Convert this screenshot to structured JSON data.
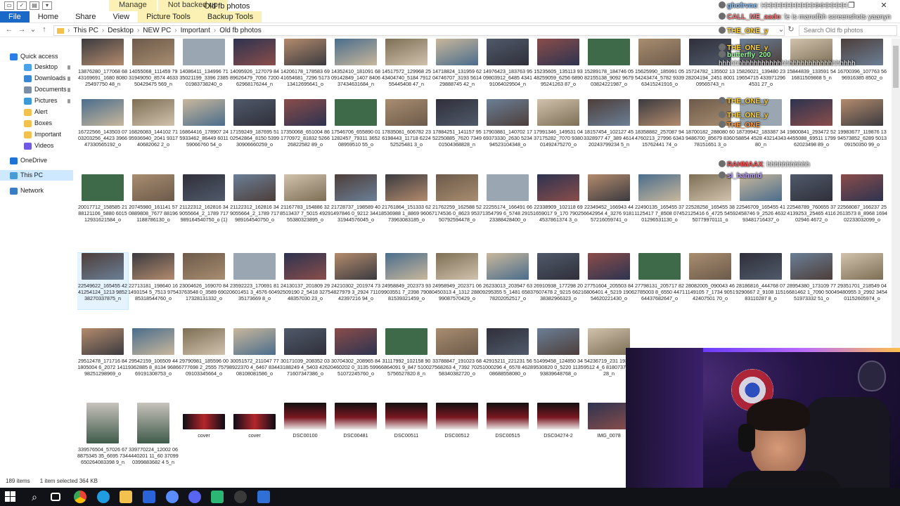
{
  "window": {
    "title": "Old fb photos",
    "context_tabs": [
      "Manage",
      "Not backed up"
    ],
    "menu_tabs": [
      "File",
      "Home",
      "Share",
      "View",
      "Picture Tools",
      "Backup Tools"
    ]
  },
  "address": {
    "crumbs": [
      "This PC",
      "Desktop",
      "NEW PC",
      "Important",
      "Old fb photos"
    ],
    "search_placeholder": "Search Old fb photos"
  },
  "sidebar": {
    "items": [
      {
        "label": "Quick access",
        "icon": "star-icon",
        "color": "#2b7de9",
        "pinned": false
      },
      {
        "label": "Desktop",
        "icon": "desktop-icon",
        "color": "#4aa3e8",
        "pinned": true
      },
      {
        "label": "Downloads",
        "icon": "download-icon",
        "color": "#3b86d4",
        "pinned": true
      },
      {
        "label": "Documents",
        "icon": "document-icon",
        "color": "#7a8fa6",
        "pinned": true
      },
      {
        "label": "Pictures",
        "icon": "pictures-icon",
        "color": "#3c9ad9",
        "pinned": true
      },
      {
        "label": "Alert",
        "icon": "folder-icon",
        "color": "#f2c14e",
        "pinned": false
      },
      {
        "label": "Boxes",
        "icon": "folder-icon",
        "color": "#f2c14e",
        "pinned": false
      },
      {
        "label": "Important",
        "icon": "folder-icon",
        "color": "#f2c14e",
        "pinned": false
      },
      {
        "label": "Videos",
        "icon": "video-icon",
        "color": "#6e5ae6",
        "pinned": false
      },
      {
        "label": "OneDrive",
        "icon": "cloud-icon",
        "color": "#1f73d8",
        "pinned": false
      },
      {
        "label": "This PC",
        "icon": "computer-icon",
        "color": "#4a9ad6",
        "pinned": false
      },
      {
        "label": "Network",
        "icon": "network-icon",
        "color": "#3b7dc4",
        "pinned": false
      }
    ]
  },
  "files": [
    [
      "13876280_177068 6843169691_1680 808025497750 48_n",
      "14055068_111459 7931949050_8574 463350429475 569_n",
      "14086411_134996 7135021199_3396 238501983738240_o",
      "14095926_127079 8489626479_7056 720062968176244_n",
      "14206178_178583 6941654681_7296 517313412695641_o",
      "14352410_181091 6809142849_1407 840637434631684_n",
      "14517572_129968 2543404740_5184 791255445408 47_n",
      "14718824_131959 6204746707_3193 561429888745 42_n",
      "14976423_183763 9509803912_6485 434191064029504_n",
      "15235605_135113 9348259059_6256 689095241263 87_o",
      "15289178_184746 0582155138_9092 967903824221987_o",
      "15625990_185991 0554243474_5782 933963415241916_o",
      "15724782_135502 1328204194_2451 800109565743_n",
      "15826021_139480 2319654715 4339712964531 27_o",
      "15844839_133591 5416811509868 5_n",
      "16700396_107763 5696916385 8502_o"
    ],
    [
      "16722566_143503 0703203256_4423 396647330565192_o",
      "16826083_144102 7195936940_2041 931740682062 2_o",
      "16864416_178907 245933462_86449 601159066760 54_o",
      "17159249_187695 5102542864_8150 539930906660259_o",
      "17350068_651004 861770972_81832 526626822582 89_o",
      "17546706_655890 011282457_79311 365208959510 55_o",
      "17835081_606782 236198443_11718 622452525481 3_o",
      "17884251_141157 9552250885_7620 734901504368828_n",
      "17903881_140702 1769373330_2630 523494523104348_o",
      "17991346_149531 0437175282_7070 938001492475270_o",
      "18157454_102127 453328977 47_389 461420243799234 5_n",
      "18358882_257087 944760213_27996 634315762441 74_o",
      "18700182_288080 609486700_85679 836078151651 3_o",
      "18739942_183387 3458854 4528 4321434380_n",
      "19800841_293472 524455088_69511 179962023498 89_o",
      "19983677_119876 1394573852_6289 501309150350 99_o"
    ],
    [
      "20017712_158585 2188121106_5880 601512931621584_o",
      "20745980_161141 570889808_7677 881961188786130_o",
      "21122312_162816 349055664_2_1789 717989164540750_o (1)",
      "21122312_162816 349055664_2_1789 717989164540750_o",
      "21167783_154886 328513437 7_5015 492955380323895_o",
      "21728737_198589 401497846 0_9212 344131944576045_o",
      "21761864_151333 628536988 1_8869 960673963083185_o",
      "21762259_162588 527174536 0_8623 953750792594478_o",
      "22255174_166491 661354799 6_5748 291523388428400_o",
      "22338909_102118 691659017 9_170 790254537861374 3_o",
      "22349452_166943 446642954 4_3276 918157216059741_o",
      "22490135_165455 371125417 7_8508 074501296531130_o",
      "22528258_165455 382125416 6_4725 545950779970111_o",
      "22546709_165455 412458746 9_2526 463293481716437_o",
      "22548789_760655 374139253_25465 411602946 4672_o",
      "22568087_166237 252613573 8_8968 169402233032099_o"
    ],
    [
      "22549622_165455 4241254124_1213 985238270337875_n",
      "22713181_198640 161493154 5_7513 975485318544760_o",
      "23004626_169070 843763548 0_3589 690217328131332_o",
      "23592223_170691 810601451 3_4576 604935173669 8_o",
      "24130137_201809 292509190 2_5418 327548357030 23_o",
      "24210302_201974 734827979 3_2924 711042397216 94_o",
      "24958849_202373 939903551 7_2398 790881539321459_o",
      "24958949_202371 060450313 4_1312 288099087570429_o",
      "26233013_203947 639295355 5_1481 658378202052517_o",
      "26910938_177298 207607478 2_9215 662138382966323_o",
      "27751604_205503 846806401 4_5219 190654620221430_o",
      "27798131_205717 822785003 8_6550 447164437682647_o",
      "28082005_090043 461149105 7_1734 905142407501 70_o",
      "28186816_444768 079290667 2_9108 115183110287 8_o",
      "28954380_173109 776681462 1_7090 500451973332 51_o",
      "29351701_218549 049480955 3_2992 345401152605974_o"
    ],
    [
      "29512478_171716 841805004 6_2072 141198251298969_o",
      "29542159_106509 449362885 8_8134 968669191308753_o",
      "29790981_185596 006777698 2_2555 757909103345664_o",
      "30051572_211047 778922370 4_6467 834408108081586_o",
      "30171039_208352 033188249 4_5403 426271607347386_o",
      "30704302_208965 840460202 0_3135 599651072245760_o",
      "31117992_102158 906864091 9_847 510025756527820 8_n",
      "33788847_191023 687568263 4_7392 702558340382720_o",
      "42915211_221231 561000296 4_6578 462808688558080_o",
      "51499458_124850 349530820 0_5220 113593839648768_o",
      "54236719_231 193529512 4_6 818073737428_n",
      "",
      "",
      "",
      "",
      ""
    ],
    [
      "339576504_57026 678875345 35_6695 734650264083398 9_n",
      "339770224_12002 064440201 11_60 370990399883682 4 5_n",
      "cover",
      "cover",
      "DSC00100",
      "DSC00481",
      "DSC00511",
      "DSC00512",
      "DSC00515",
      "DSC04274-2",
      "IMG_0078",
      "",
      "",
      "",
      "",
      ""
    ]
  ],
  "status": {
    "items_count": "189 items",
    "selection": "1 item selected  364 KB"
  },
  "chat": [
    {
      "user": "ghofrvne",
      "msg": ": HHHHHHHHHHHHHHHHH",
      "color": "#8ec6ff"
    },
    {
      "user": "CALL_ME_aado",
      "msg": ": le is manofbh screenshots yaanyn",
      "color": "#ff7a7a"
    },
    {
      "user": "THE_ONE_y",
      "msg": "",
      "color": "#ffd23c"
    },
    {
      "user": "THE_ONE_y",
      "msg": "",
      "color": "#ffd23c"
    },
    {
      "user": "butterfly_200",
      "msg": "",
      "color": "#9bff9b"
    },
    {
      "user": "",
      "msg": "hhhhhhhhhhhhhhhhhhhhhhhhhhhhhhhhhhh",
      "color": "#ffffff"
    },
    {
      "user": "THE_ONE_y",
      "msg": "",
      "color": "#ffd23c"
    },
    {
      "user": "THE_ONE_y",
      "msg": "",
      "color": "#ffd23c"
    },
    {
      "user": "THE_ONE",
      "msg": "",
      "color": "#ff9a3c"
    },
    {
      "user": "RAHMAAX",
      "msg": ": hhhhhhhhhhh",
      "color": "#ff5252"
    },
    {
      "user": "si_bahmid",
      "msg": "",
      "color": "#c0a6ff"
    }
  ]
}
